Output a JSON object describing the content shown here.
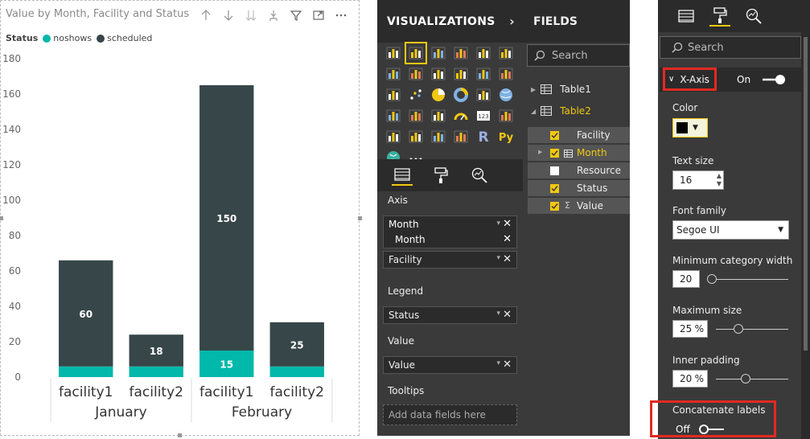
{
  "chart": {
    "title": "Value by Month, Facility and Status",
    "legend_title": "Status",
    "legend": [
      {
        "name": "noshows",
        "color": "#01b8aa"
      },
      {
        "name": "scheduled",
        "color": "#374649"
      }
    ],
    "toolbar_icons": [
      "drill-up-icon",
      "drill-down-icon",
      "expand-all-icon",
      "expand-hierarchy-icon",
      "filter-icon",
      "focus-mode-icon",
      "more-options-icon"
    ]
  },
  "chart_data": {
    "type": "bar",
    "stacked": true,
    "title": "Value by Month, Facility and Status",
    "categories": [
      "facility1",
      "facility2",
      "facility1",
      "facility2"
    ],
    "groups": [
      {
        "name": "January",
        "categories": [
          0,
          1
        ]
      },
      {
        "name": "February",
        "categories": [
          2,
          3
        ]
      }
    ],
    "series": [
      {
        "name": "noshows",
        "color": "#01b8aa",
        "values": [
          6,
          6,
          15,
          6
        ],
        "labels": [
          "",
          "",
          "15",
          ""
        ]
      },
      {
        "name": "scheduled",
        "color": "#374649",
        "values": [
          60,
          18,
          150,
          25
        ],
        "labels": [
          "60",
          "18",
          "150",
          "25"
        ]
      }
    ],
    "ylim": [
      0,
      180
    ],
    "yticks": [
      0,
      20,
      40,
      60,
      80,
      100,
      120,
      140,
      160,
      180
    ],
    "grid": false,
    "legend_position": "top-left"
  },
  "viz": {
    "title": "VISUALIZATIONS",
    "icons": [
      "stacked-bar-icon",
      "stacked-column-icon",
      "clustered-bar-icon",
      "clustered-column-icon",
      "100-bar-icon",
      "100-column-icon",
      "line-icon",
      "area-icon",
      "stacked-area-icon",
      "line-column-icon",
      "line-clustered-icon",
      "ribbon-icon",
      "waterfall-icon",
      "scatter-icon",
      "pie-icon",
      "donut-icon",
      "treemap-icon",
      "map-icon",
      "filled-map-icon",
      "shape-map-icon",
      "funnel-icon",
      "gauge-icon",
      "card-icon",
      "multirow-card-icon",
      "kpi-icon",
      "slicer-icon",
      "table-icon",
      "matrix-icon",
      "r-visual-icon",
      "python-visual-icon",
      "arcgis-icon",
      "more-visuals-icon"
    ],
    "selected_icon": 1,
    "r_label": "R",
    "py_label": "Py",
    "more_label": "···",
    "axis_label": "Axis",
    "axis_fields": [
      "Month",
      "Month"
    ],
    "axis_field2": "Facility",
    "legend_label": "Legend",
    "legend_field": "Status",
    "value_label": "Value",
    "value_field": "Value",
    "tooltips_label": "Tooltips",
    "tooltips_placeholder": "Add data fields here"
  },
  "fields": {
    "title": "FIELDS",
    "search_placeholder": "Search",
    "tables": [
      {
        "name": "Table1",
        "color": "#eeeeee"
      },
      {
        "name": "Table2",
        "color": "#f2c811"
      }
    ],
    "items": [
      {
        "name": "Facility",
        "checked": true,
        "type": "text"
      },
      {
        "name": "Month",
        "checked": true,
        "type": "hierarchy",
        "color": "#f2c811"
      },
      {
        "name": "Resource",
        "checked": false,
        "type": "text"
      },
      {
        "name": "Status",
        "checked": true,
        "type": "text"
      },
      {
        "name": "Value",
        "checked": true,
        "type": "sum"
      }
    ],
    "sigma": "Σ"
  },
  "format": {
    "search_placeholder": "Search",
    "section": "X-Axis",
    "section_toggle": "On",
    "color_label": "Color",
    "text_size_label": "Text size",
    "text_size": "16",
    "font_family_label": "Font family",
    "font_family": "Segoe UI",
    "min_cat_width_label": "Minimum category width",
    "min_cat_width": "20",
    "max_size_label": "Maximum size",
    "max_size": "25",
    "inner_padding_label": "Inner padding",
    "inner_padding": "20",
    "pct": "%",
    "concat_label": "Concatenate labels",
    "concat_toggle": "Off",
    "accent": "#f2c811",
    "highlight": "#e22a22"
  }
}
